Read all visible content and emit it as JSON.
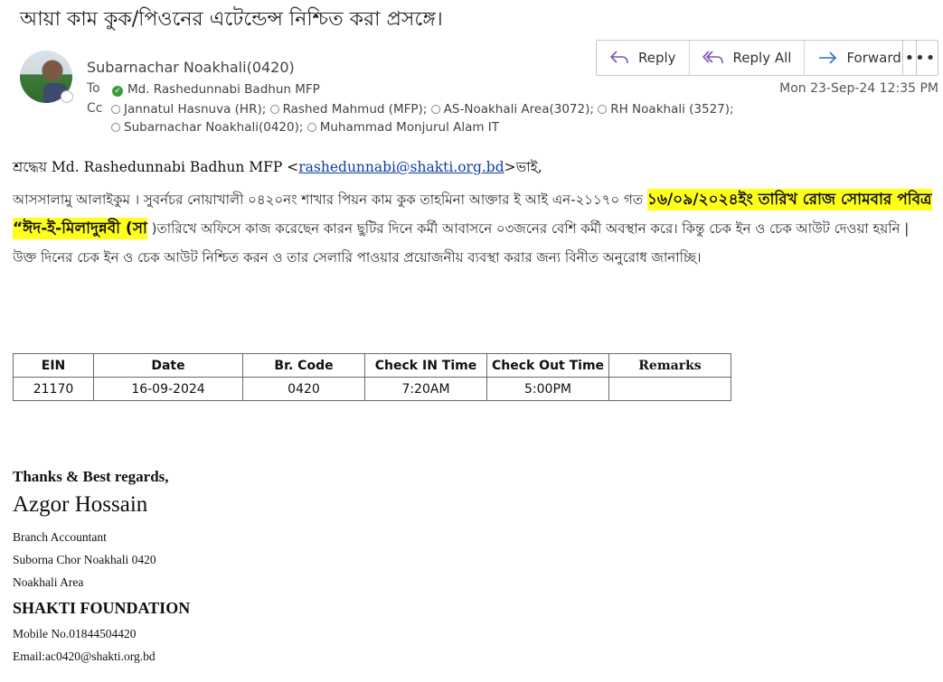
{
  "email": {
    "subject": "আয়া কাম কুক/পিওনের এটেন্ডেন্স নিশ্চিত করা প্রসঙ্গে।",
    "sender": "Subarnachar Noakhali(0420)",
    "to_label": "To",
    "cc_label": "Cc",
    "to": "Md. Rashedunnabi Badhun MFP",
    "cc_line1": [
      "Jannatul Hasnuva (HR);",
      "Rashed Mahmud (MFP);",
      "AS-Noakhali Area(3072);",
      "RH Noakhali (3527);"
    ],
    "cc_line2": [
      "Subarnachar Noakhali(0420);",
      "Muhammad Monjurul Alam IT"
    ],
    "datetime": "Mon 23-Sep-24 12:35 PM",
    "actions": {
      "reply": "Reply",
      "reply_all": "Reply All",
      "forward": "Forward",
      "more": "•••"
    }
  },
  "body": {
    "greeting_prefix": "শ্রদ্ধেয় Md. Rashedunnabi Badhun MFP <",
    "greeting_link": "rashedunnabi@shakti.org.bd",
    "greeting_suffix": ">ভাই,",
    "para_part1": "আসসালামু আলাইকুম । সুবর্নচর নোয়াখালী ০৪২০নং শাখার  পিয়ন কাম কুক তাহমিনা আক্তার ই আই এন-২১১৭০  গত ",
    "para_highlight": "১৬/০৯/২০২৪ইং  তারিখ রোজ সোমবার পবিত্র “ঈদ-ই-মিলাদুন্নবী (সা",
    "para_part2": " )তারিখে অফিসে কাজ করেছেন কারন ছুটির দিনে কর্মী আবাসনে ০৩জনের বেশি কর্মী অবস্থান করে। কিন্তু চেক ইন ও চেক আউট দেওয়া হয়নি   |     উক্ত দিনের  চেক ইন ও চেক আউট নিশ্চিত করন ও তার সেলারি পাওয়ার প্রয়োজনীয় ব্যবস্থা করার জন্য বিনীত অনুরোধ জানাচ্ছি।"
  },
  "table": {
    "headers": [
      "EIN",
      "Date",
      "Br. Code",
      "Check IN Time",
      "Check Out Time",
      "Remarks"
    ],
    "rows": [
      [
        "21170",
        "16-09-2024",
        "0420",
        "7:20AM",
        "5:00PM",
        ""
      ]
    ]
  },
  "signature": {
    "closing": "Thanks & Best regards,",
    "name": "Azgor Hossain",
    "title": "Branch Accountant",
    "branch": "Suborna Chor Noakhali 0420",
    "area": "Noakhali Area",
    "org": "SHAKTI FOUNDATION",
    "mobile": "Mobile No.01844504420",
    "email": "Email:ac0420@shakti.org.bd"
  }
}
